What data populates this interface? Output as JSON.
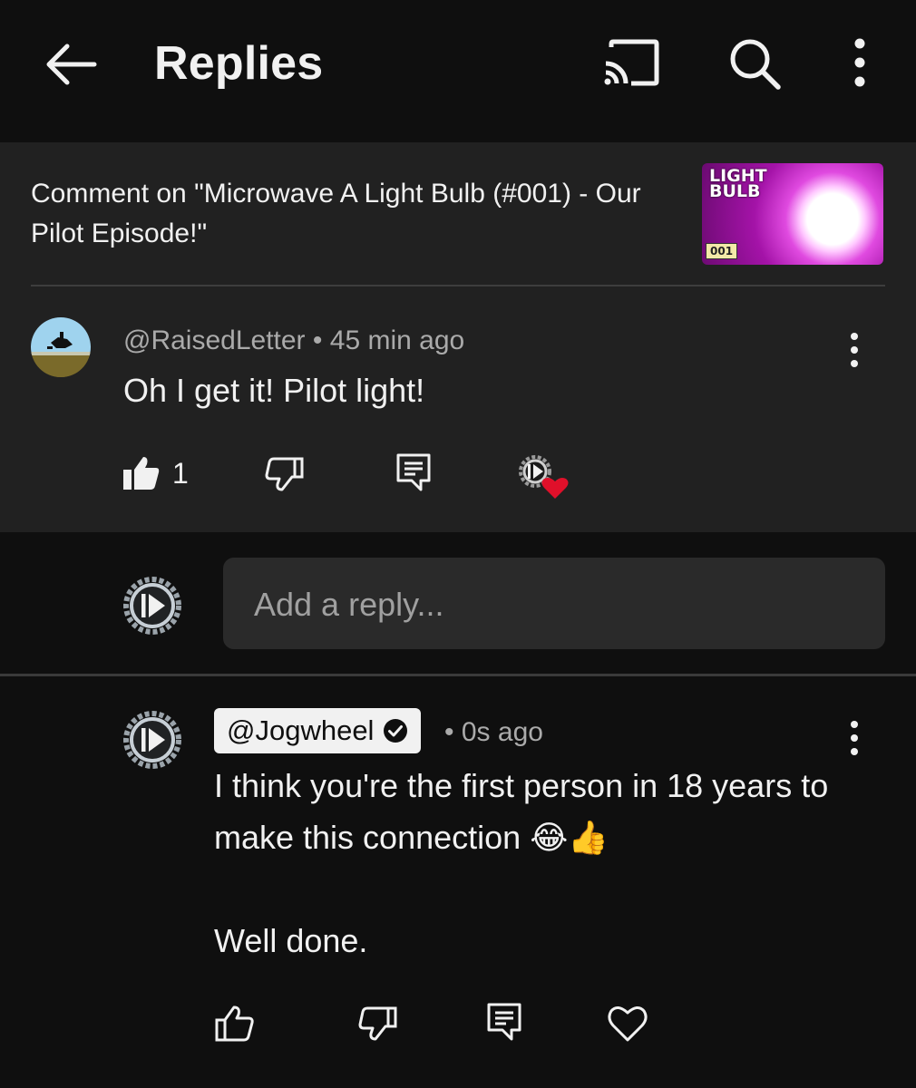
{
  "header": {
    "title": "Replies",
    "icons": [
      "back-arrow-icon",
      "cast-icon",
      "search-icon",
      "more-vert-icon"
    ]
  },
  "parent_comment": {
    "context": "Comment on \"Microwave A Light Bulb (#001) - Our Pilot Episode!\"",
    "thumbnail": {
      "title": "LIGHT BULB",
      "number": "001"
    },
    "author": "@RaisedLetter",
    "time": "45 min ago",
    "separator": "•",
    "text": "Oh I get it! Pilot light!",
    "like_count": "1"
  },
  "composer": {
    "placeholder": "Add a reply..."
  },
  "reply_comment": {
    "author": "@Jogwheel",
    "verified": true,
    "time": "0s ago",
    "separator": "•",
    "text": "I think you're the first person in 18 years to make this connection 😂👍\n\nWell done."
  },
  "colors": {
    "background": "#0f0f0f",
    "panel": "#212121",
    "input": "#2a2a2a",
    "heart": "#e0102a",
    "secondary_text": "#aaaaaa"
  }
}
